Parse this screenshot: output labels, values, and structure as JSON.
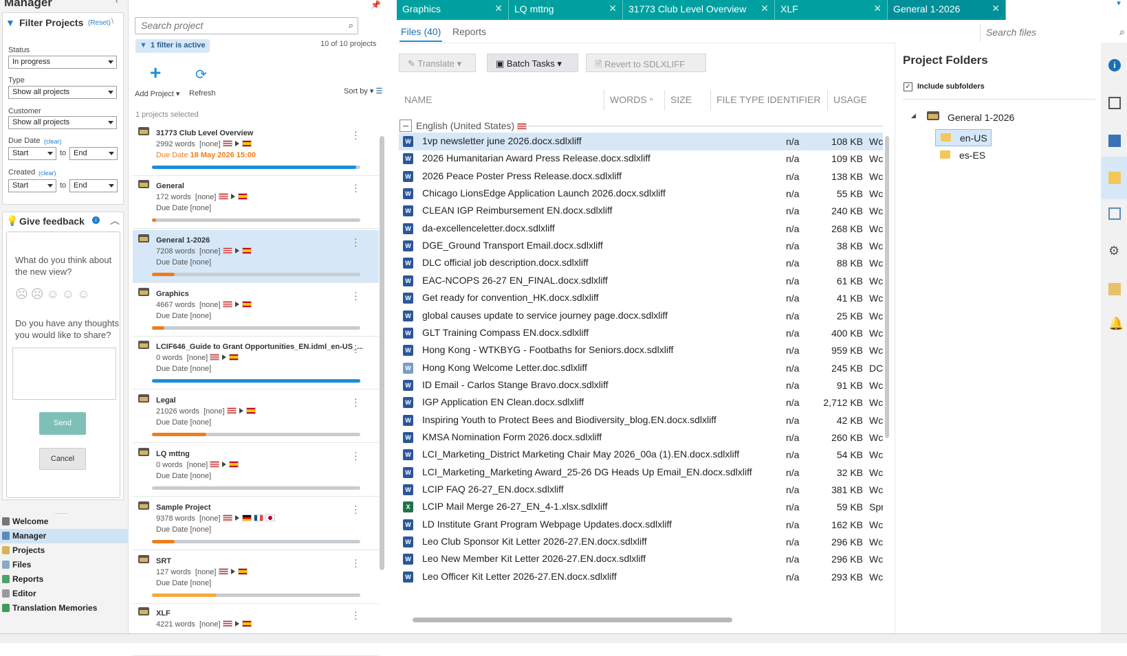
{
  "app_title": "Manager",
  "filter": {
    "title": "Filter Projects",
    "reset": "(Reset)",
    "status_label": "Status",
    "status_value": "In progress",
    "type_label": "Type",
    "type_value": "Show all projects",
    "customer_label": "Customer",
    "customer_value": "Show all projects",
    "due_label": "Due Date",
    "due_clear": "(clear)",
    "due_start": "Start",
    "to": "to",
    "due_end": "End",
    "created_label": "Created",
    "created_clear": "(clear)",
    "created_start": "Start",
    "created_end": "End"
  },
  "feedback": {
    "title": "Give feedback",
    "q1": "What do you think about the new view?",
    "q2": "Do you have any thoughts you would like to share?",
    "send": "Send",
    "cancel": "Cancel"
  },
  "nav": [
    "Welcome",
    "Manager",
    "Projects",
    "Files",
    "Reports",
    "Editor",
    "Translation Memories"
  ],
  "projects_panel": {
    "search_placeholder": "Search project",
    "filter_badge": "1 filter is active",
    "count": "10 of 10 projects",
    "add_project": "Add Project",
    "refresh": "Refresh",
    "sort_by": "Sort by",
    "selected": "1 projects selected",
    "due_prefix": "Due Date",
    "projects": [
      {
        "name": "31773 Club Level Overview",
        "words": "2992 words",
        "tag": "[none]",
        "due": "18 May 2026 15:00",
        "progress": 0.98,
        "color": "#1a8fd8",
        "flags": [
          "us",
          "es"
        ]
      },
      {
        "name": "General",
        "words": "172 words",
        "tag": "[none]",
        "due": "[none]",
        "progress": 0.02,
        "color": "#ef7d1a",
        "flags": [
          "us",
          "es"
        ]
      },
      {
        "name": "General 1-2026",
        "words": "7208 words",
        "tag": "[none]",
        "due": "[none]",
        "progress": 0.11,
        "color": "#ef7d1a",
        "flags": [
          "us",
          "es"
        ]
      },
      {
        "name": "Graphics",
        "words": "4667 words",
        "tag": "[none]",
        "due": "[none]",
        "progress": 0.06,
        "color": "#ef7d1a",
        "flags": [
          "us",
          "es"
        ]
      },
      {
        "name": "LCIF646_Guide to Grant Opportunities_EN.idml_en-US_...",
        "words": "0 words",
        "tag": "[none]",
        "due": "[none]",
        "progress": 1.0,
        "color": "#1a8fd8",
        "flags": [
          "us",
          "es"
        ]
      },
      {
        "name": "Legal",
        "words": "21026 words",
        "tag": "[none]",
        "due": "[none]",
        "progress": 0.26,
        "color": "#ef7d1a",
        "flags": [
          "us",
          "es"
        ]
      },
      {
        "name": "LQ mttng",
        "words": "0 words",
        "tag": "[none]",
        "due": "[none]",
        "progress": 0.0,
        "color": "#ef7d1a",
        "flags": [
          "us",
          "es"
        ]
      },
      {
        "name": "Sample Project",
        "words": "9378 words",
        "tag": "[none]",
        "due": "[none]",
        "progress": 0.11,
        "color": "#ef7d1a",
        "flags": [
          "us",
          "de",
          "fr",
          "jp"
        ]
      },
      {
        "name": "SRT",
        "words": "127 words",
        "tag": "[none]",
        "due": "[none]",
        "progress": 0.31,
        "color": "#f7a93a",
        "flags": [
          "us",
          "es"
        ]
      },
      {
        "name": "XLF",
        "words": "4221 words",
        "tag": "[none]",
        "due": "",
        "progress": 0.0,
        "color": "#ef7d1a",
        "flags": [
          "us",
          "es"
        ]
      }
    ]
  },
  "tabs": [
    "Graphics",
    "LQ mttng",
    "31773 Club Level Overview",
    "XLF",
    "General 1-2026"
  ],
  "subtabs": {
    "files": "Files (40)",
    "reports": "Reports"
  },
  "search_files_placeholder": "Search files",
  "toolbar": {
    "translate": "Translate",
    "batch": "Batch Tasks",
    "revert": "Revert to SDLXLIFF"
  },
  "columns": {
    "name": "NAME",
    "words": "WORDS",
    "size": "SIZE",
    "fti": "FILE TYPE IDENTIFIER",
    "usage": "USAGE"
  },
  "group_label": "English (United States)",
  "files": [
    {
      "name": "1vp newsletter june 2026.docx.sdlxliff",
      "words": "n/a",
      "size": "108 KB",
      "usage": "Wc",
      "t": "w"
    },
    {
      "name": "2026 Humanitarian Award Press Release.docx.sdlxliff",
      "words": "n/a",
      "size": "109 KB",
      "usage": "Wc",
      "t": "w"
    },
    {
      "name": "2026 Peace Poster Press Release.docx.sdlxliff",
      "words": "n/a",
      "size": "138 KB",
      "usage": "Wc",
      "t": "w"
    },
    {
      "name": "Chicago LionsEdge Application Launch 2026.docx.sdlxliff",
      "words": "n/a",
      "size": "55 KB",
      "usage": "Wc",
      "t": "w"
    },
    {
      "name": "CLEAN IGP Reimbursement EN.docx.sdlxliff",
      "words": "n/a",
      "size": "240 KB",
      "usage": "Wc",
      "t": "w"
    },
    {
      "name": "da-excellenceletter.docx.sdlxliff",
      "words": "n/a",
      "size": "268 KB",
      "usage": "Wc",
      "t": "w"
    },
    {
      "name": "DGE_Ground Transport Email.docx.sdlxliff",
      "words": "n/a",
      "size": "38 KB",
      "usage": "Wc",
      "t": "w"
    },
    {
      "name": "DLC official job description.docx.sdlxliff",
      "words": "n/a",
      "size": "88 KB",
      "usage": "Wc",
      "t": "w"
    },
    {
      "name": "EAC-NCOPS 26-27 EN_FINAL.docx.sdlxliff",
      "words": "n/a",
      "size": "61 KB",
      "usage": "Wc",
      "t": "w"
    },
    {
      "name": "Get ready for convention_HK.docx.sdlxliff",
      "words": "n/a",
      "size": "41 KB",
      "usage": "Wc",
      "t": "w"
    },
    {
      "name": "global causes update to service journey page.docx.sdlxliff",
      "words": "n/a",
      "size": "25 KB",
      "usage": "Wc",
      "t": "w"
    },
    {
      "name": "GLT Training Compass EN.docx.sdlxliff",
      "words": "n/a",
      "size": "400 KB",
      "usage": "Wc",
      "t": "w"
    },
    {
      "name": "Hong Kong - WTKBYG - Footbaths for Seniors.docx.sdlxliff",
      "words": "n/a",
      "size": "959 KB",
      "usage": "Wc",
      "t": "w"
    },
    {
      "name": "Hong Kong Welcome Letter.doc.sdlxliff",
      "words": "n/a",
      "size": "245 KB",
      "usage": "DC",
      "t": "d"
    },
    {
      "name": "ID Email - Carlos Stange Bravo.docx.sdlxliff",
      "words": "n/a",
      "size": "91 KB",
      "usage": "Wc",
      "t": "w"
    },
    {
      "name": "IGP Application EN Clean.docx.sdlxliff",
      "words": "n/a",
      "size": "2,712 KB",
      "usage": "Wc",
      "t": "w"
    },
    {
      "name": "Inspiring Youth to Protect Bees and Biodiversity_blog.EN.docx.sdlxliff",
      "words": "n/a",
      "size": "42 KB",
      "usage": "Wc",
      "t": "w"
    },
    {
      "name": "KMSA Nomination Form 2026.docx.sdlxliff",
      "words": "n/a",
      "size": "260 KB",
      "usage": "Wc",
      "t": "w"
    },
    {
      "name": "LCI_Marketing_District Marketing Chair May 2026_00a (1).EN.docx.sdlxliff",
      "words": "n/a",
      "size": "54 KB",
      "usage": "Wc",
      "t": "w"
    },
    {
      "name": "LCI_Marketing_Marketing Award_25-26 DG Heads Up Email_EN.docx.sdlxliff",
      "words": "n/a",
      "size": "32 KB",
      "usage": "Wc",
      "t": "w"
    },
    {
      "name": "LCIP FAQ 26-27_EN.docx.sdlxliff",
      "words": "n/a",
      "size": "381 KB",
      "usage": "Wc",
      "t": "w"
    },
    {
      "name": "LCIP Mail Merge 26-27_EN_4-1.xlsx.sdlxliff",
      "words": "n/a",
      "size": "59 KB",
      "usage": "Spr",
      "t": "x"
    },
    {
      "name": "LD Institute Grant Program Webpage Updates.docx.sdlxliff",
      "words": "n/a",
      "size": "162 KB",
      "usage": "Wc",
      "t": "w"
    },
    {
      "name": "Leo Club Sponsor Kit Letter 2026-27.EN.docx.sdlxliff",
      "words": "n/a",
      "size": "296 KB",
      "usage": "Wc",
      "t": "w"
    },
    {
      "name": "Leo New Member Kit Letter 2026-27.EN.docx.sdlxliff",
      "words": "n/a",
      "size": "296 KB",
      "usage": "Wc",
      "t": "w"
    },
    {
      "name": "Leo Officer Kit Letter 2026-27.EN.docx.sdlxliff",
      "words": "n/a",
      "size": "293 KB",
      "usage": "Wc",
      "t": "w"
    }
  ],
  "folders": {
    "title": "Project Folders",
    "include_sub": "Include subfolders",
    "root": "General 1-2026",
    "children": [
      "en-US",
      "es-ES"
    ]
  }
}
